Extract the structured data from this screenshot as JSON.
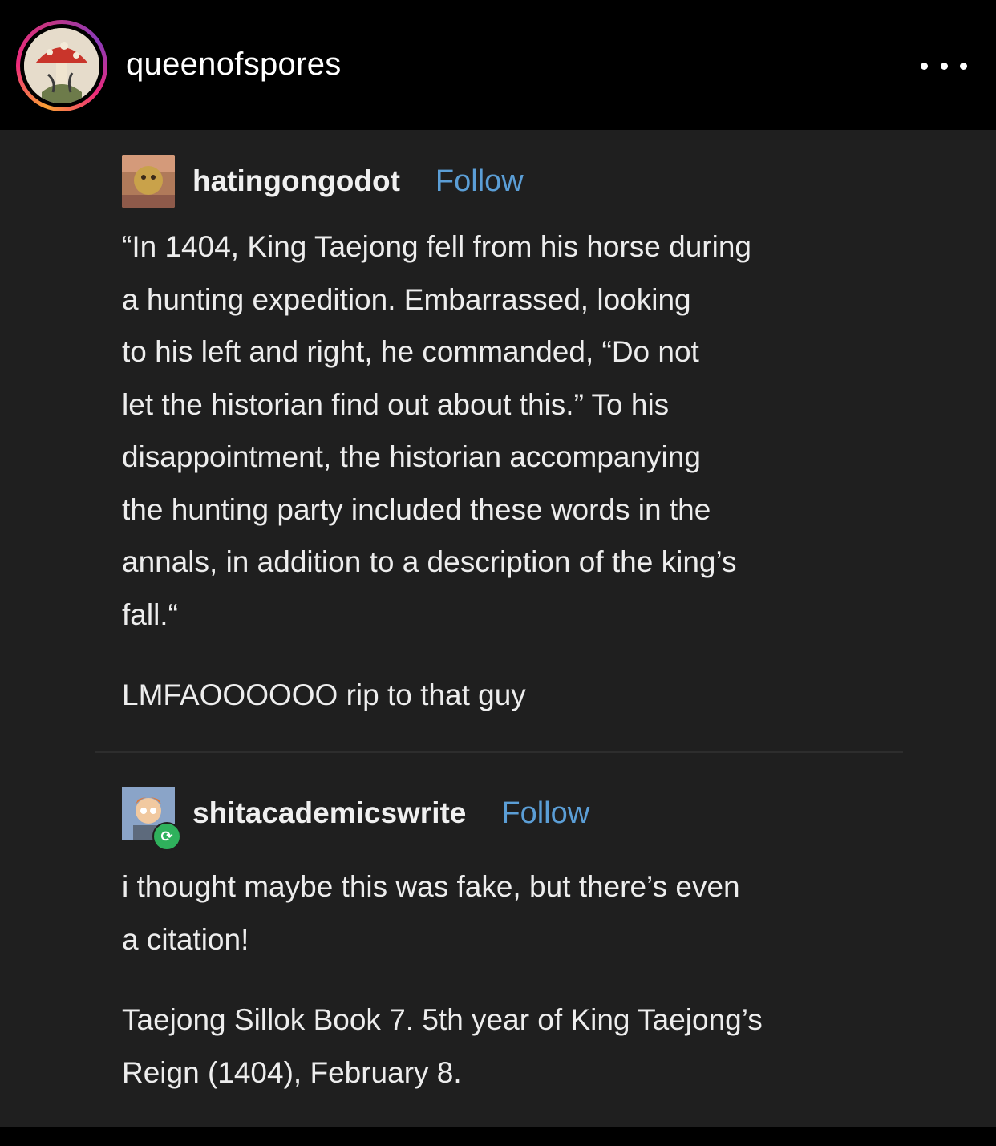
{
  "instagram": {
    "username": "queenofspores",
    "more_icon": "more-horizontal-icon"
  },
  "posts": [
    {
      "blog_name": "hatingongodot",
      "follow_label": "Follow",
      "paragraphs": [
        "“In 1404, King Taejong fell from his horse during\na hunting expedition. Embarrassed, looking\nto his left and right, he commanded, “Do not\nlet the historian find out about this.” To his\ndisappointment, the historian accompanying\nthe hunting party included these words in the\nannals, in addition to a description of the king’s\nfall.“",
        "LMFAOOOOOO rip to that guy"
      ]
    },
    {
      "blog_name": "shitacademicswrite",
      "follow_label": "Follow",
      "badge_icon": "reblog-icon",
      "paragraphs": [
        "i thought maybe this was fake, but there’s even\na citation!",
        "Taejong Sillok Book 7. 5th year of King Taejong’s\nReign (1404), February 8."
      ]
    }
  ],
  "colors": {
    "background": "#000000",
    "post_background": "#1f1f1f",
    "follow_link": "#5b9ed6",
    "text": "#ededed",
    "reblog_badge": "#2fb15c"
  }
}
